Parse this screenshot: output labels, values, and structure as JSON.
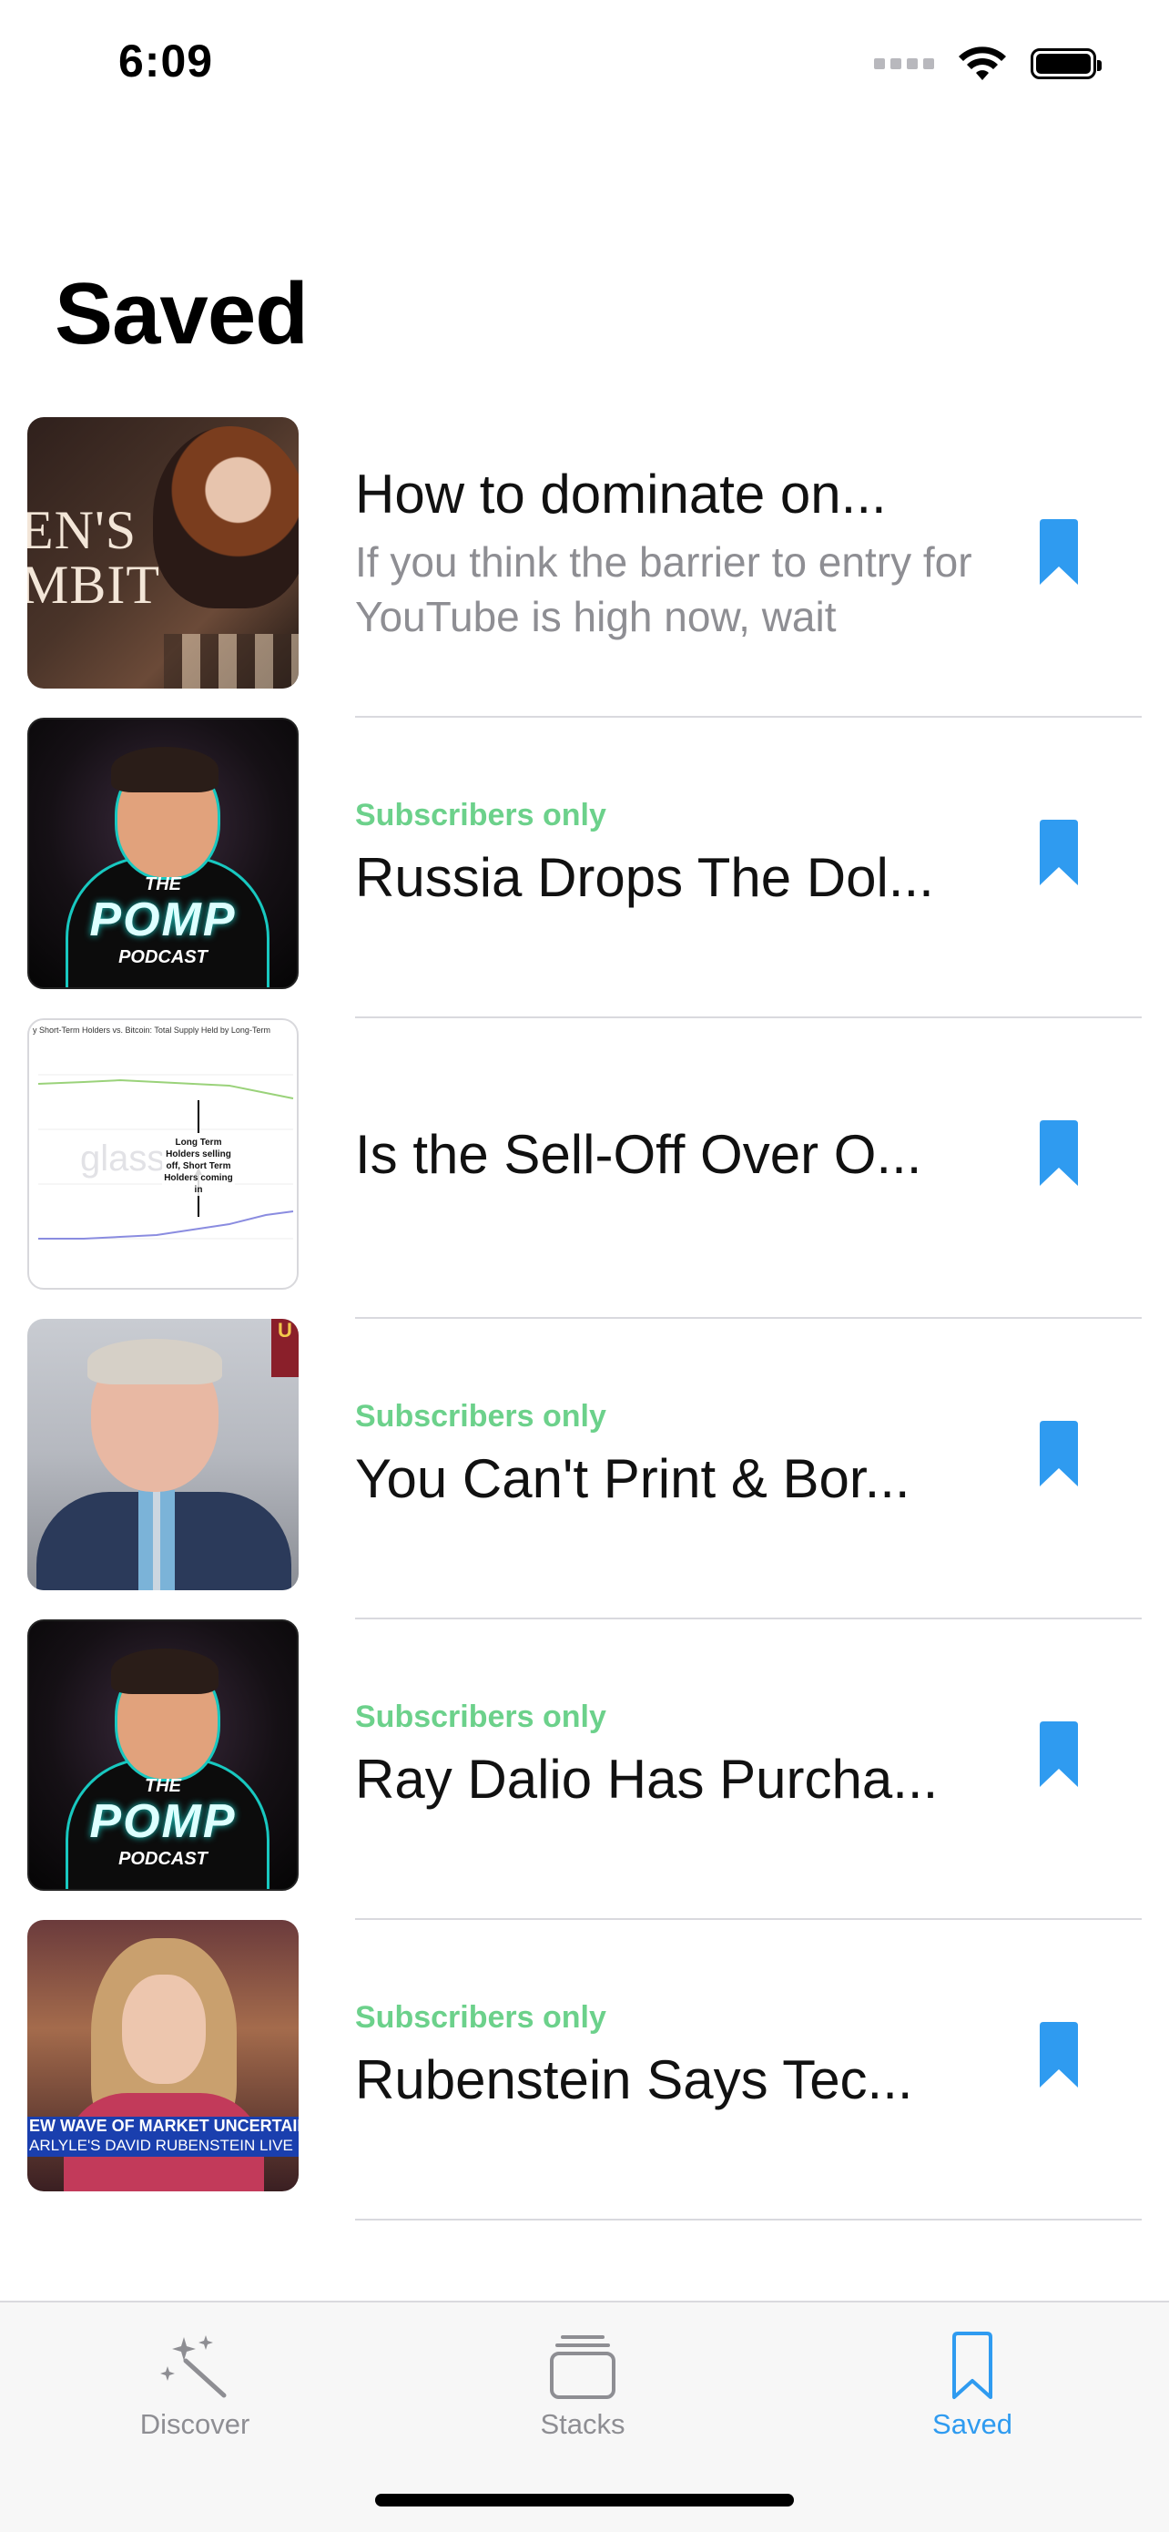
{
  "status_bar": {
    "time": "6:09"
  },
  "page": {
    "title": "Saved"
  },
  "colors": {
    "accent": "#2f9bf0",
    "subscriber_badge": "#6cd18b",
    "secondary_text": "#8e8e93"
  },
  "items": [
    {
      "badge": "",
      "title": "How to dominate on...",
      "description": "If you think the barrier to entry for YouTube is high now, wait",
      "thumbnail": {
        "kind": "poster",
        "text": [
          "EN'S",
          "MBIT"
        ]
      },
      "bookmarked": true
    },
    {
      "badge": "Subscribers only",
      "title": "Russia Drops The Dol...",
      "description": "",
      "thumbnail": {
        "kind": "podcast-cover",
        "text": [
          "THE",
          "POMP",
          "PODCAST"
        ]
      },
      "bookmarked": true
    },
    {
      "badge": "",
      "title": "Is the Sell-Off Over O...",
      "description": "",
      "thumbnail": {
        "kind": "chart",
        "text": [
          "y Short-Term Holders vs. Bitcoin: Total Supply Held by Long-Term",
          "glass",
          "Long Term Holders selling off, Short Term Holders coming in"
        ]
      },
      "bookmarked": true
    },
    {
      "badge": "Subscribers only",
      "title": "You Can't Print & Bor...",
      "description": "",
      "thumbnail": {
        "kind": "video-still",
        "text": [
          "U"
        ]
      },
      "bookmarked": true
    },
    {
      "badge": "Subscribers only",
      "title": "Ray Dalio Has Purcha...",
      "description": "",
      "thumbnail": {
        "kind": "podcast-cover",
        "text": [
          "THE",
          "POMP",
          "PODCAST"
        ]
      },
      "bookmarked": true
    },
    {
      "badge": "Subscribers only",
      "title": "Rubenstein Says Tec...",
      "description": "",
      "thumbnail": {
        "kind": "news-still",
        "text": [
          "EW WAVE OF MARKET UNCERTAINTY",
          "ARLYLE'S DAVID RUBENSTEIN LIVE"
        ]
      },
      "bookmarked": true
    }
  ],
  "tab_bar": {
    "tabs": [
      {
        "label": "Discover",
        "icon": "magic-wand-icon",
        "active": false
      },
      {
        "label": "Stacks",
        "icon": "stack-icon",
        "active": false
      },
      {
        "label": "Saved",
        "icon": "bookmark-icon",
        "active": true
      }
    ]
  }
}
